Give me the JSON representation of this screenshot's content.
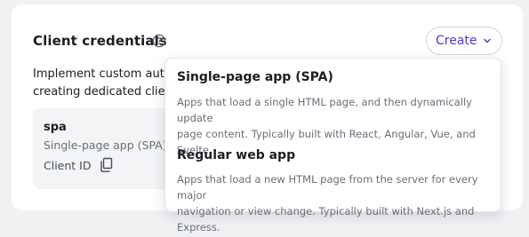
{
  "card": {
    "title": "Client credentials",
    "help_icon": "question-circle-icon",
    "description_lines": [
      "Implement custom author",
      "creating dedicated client c"
    ]
  },
  "create_button": {
    "label": "Create",
    "icon": "chevron-down-icon",
    "accent_color": "#5a34d6"
  },
  "client": {
    "name": "spa",
    "type": "Single-page app (SPA)",
    "id_label": "Client ID",
    "copy_icon": "copy-icon"
  },
  "dropdown": {
    "options": [
      {
        "title": "Single-page app (SPA)",
        "description_lines": [
          "Apps that load a single HTML page, and then dynamically update",
          "page content. Typically built with React, Angular, Vue, and Svelte."
        ]
      },
      {
        "title": "Regular web app",
        "description_lines": [
          "Apps that load a new HTML page from the server for every major",
          "navigation or view change. Typically built with Next.js and Express."
        ]
      }
    ]
  }
}
